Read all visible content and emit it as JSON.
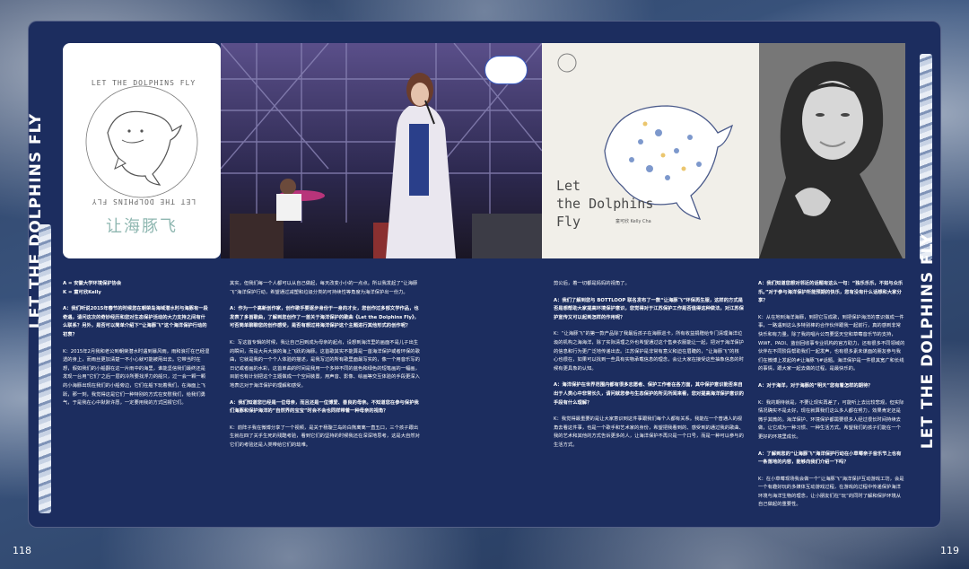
{
  "spread": {
    "side_title_left": "LET THE DOLPHINS FLY",
    "side_title_right": "LET THE DOLPHINS FLY",
    "page_left": "118",
    "page_right": "119"
  },
  "logo": {
    "ring_text_top": "LET THE DOLPHINS FLY",
    "ring_text_bottom": "LET THE DOLPHINS FLY",
    "chinese_name": "让海豚飞"
  },
  "album": {
    "title_line1": "Let",
    "title_line2": "the Dolphins",
    "title_line3": "Fly",
    "artist": "童可欣 Kelly Cha"
  },
  "text": {
    "intro1": "A = 安徽大学环境保护协会",
    "intro2": "K = 童可欣Kelly",
    "q1": "A：我们听说2015年春节的时候您在朝荣岛海域潜水时与海豚有一段奇遇，请问这次的奇妙经历和您对生态保护活动的大力支持之间有什么联系？另外，是否可以简单介绍下“让海豚飞”这个海洋保护行动的初衷？",
    "a1": "K：2015年2月我和老公到朝荣潜水时遇到暴风雨，雨和浪打在已经湿透的身上，而雨丝更加清楚一不小心就可能被甩出去。它带当时在想，假如我们的小船翻在这一片雨中的海里，谁能坚信我们最终还是发现一台用“它们”之后一层的冷所要找浮力的船只，过一会一颗一颗的小海豚出现在我们的小船旁边，它们在船下玩着我们，在海面上飞跃，那一刻，我觉得这是它们一种特别的方式在安慰我们，给我们勇气，于是我在心中默默许愿，一定要用我的方式回报它们。",
    "q2": "A：作为一个高新创作家，创作歌手要逐步身份于一身的才女，您创作过多部文学作品，也发表了多首歌曲，了解到您创作了一首关于海洋保护的歌曲《Let the Dolphins Fly》，可否简单聊聊您的创作感受，是否有想过将海洋保护这个主题进行其他形式的创作呢？",
    "a2": "K：写这首专辑的时候，我让自己回到成为母亲的起点，设想到海洋里的画面不是儿子出生的瞬间，而是大兵大浪的海上飞跃的海豚。这首歌其实不能算是一首海洋保护或者环保的歌曲，它就是我的一个个人体验的描述，是我写过的所有歌里面最写实的，像一个用音乐写的日记或者画的水彩，这首单曲的时间是我用一个多钟不同的蓝色和绿色的短笔画的一幅画，目前也有计划把这个主题做成一个空间装置，用声音、影像、绘画等交互体验的手段更深入地表达对于海洋保护的理解和感受。",
    "q3": "A：我们知道您已经是一位母亲，而且还是一位博爱、善良的母亲。不知道您在参与保护我们海豚和保护海洋的“自然界的宝宝”时会不会也同样带着一种母亲的视角？",
    "a3": "K：前阵子我在微博分享了一个视频，是关于杨璇兰岛的白熊离离一直五口，三个孩子跟出生就在四了关乎生死的残酷考验，看到它们的坚持的时候我还在深深地思考，这是大自然对它们的考验还是人类带给它们的劫难。",
    "a3b": "其实，但我们每一个人都可以从自己做起，每天改变小小的一点点。所以我发起了“让海豚飞”海洋保护行动，希望通过减塑和垃圾分类的可持续性等角度为海洋保护出一份力。",
    "a3c": "剪公后，着一切都是妈妈的视角了。",
    "q4": "A：我们了解到您与 BOTTLOOP 联名发布了一款“让海豚飞”环保再生服，这样的方式是否是想帮助大家提高环境保护意识，您觉得对于江苏保护工作是否值得这种做法，对江苏保护宣传又可以起到怎样的作用呢？",
    "a4": "K：“让海豚飞”的第一款产品除了我最后孩子在海豚巡卡，所有收益捐赠给专门清理海洋垃圾的机构之海海洋，除了实际清理之外也希望通过这个售卖衣服能让一起，把对于海洋保护的信息和行为更广泛地传递出去。江苏保护是非常有意义和迫在眉睫的，“让海豚飞”的核心也很在，如果可以找到一些具有实物承载信息的理念，会让大家在接受这些抽象信息的时候有更具象的认知。",
    "q5": "A：海洋保护在世界范围内都有很多志愿者、保护工作者在各方面，其中保护意识能否来自出于人类心中非常长久，请问就您参与生态保护的所见所闻来看，您对提高海洋保护意识的手段有什么理解？",
    "a5": "K：我觉得最重要的是让大家意识到这件事跟我们每个人都有关系。我能在一个普通人的视角去看这件事，也是一个歌手和艺术家的身份，希望把我看到的、感受到的通过我的歌曲、我的艺术和其他的方式告诉更多的人，让海洋保护不再只是一个口号，而是一种可以参与的生活方式。",
    "q6": "A：我们知道您想对邻近的话题有这么一句：“独乐乐乐，不如与众乐乐。”对于参与海洋保护所能预期的快乐，您有没有什么话想和大家分享？",
    "a6": "K：从在地到海洋海豚，到把它写成歌，到把保护海洋的意识做成一件事，一路遇到这么多特别棒的合作伙伴跟我一起前行，真的感到非常快乐和有力量。除了我的唱片公司要坚天空和草莓音乐节的支持，WWF、PADI、蓝创回收事专业机构的官方助力，还有很多不同领域的伙伴在不同阶段帮助我们一起发声，也有很多素未谋面的朋友参与我们在微博上发起的#让海豚飞#话题。海洋保护是一件很其宽广和长线的事情，跟大家一起去做的过程，是最快乐的。",
    "q7": "A：对于海洋，对于海豚的“明天”您有着怎样的期待？",
    "a7": "K：我的期待就是，不要让现实再差了，可能听上去比较悲观，但实际情况确实不是太好，现在就算我们这么多人都在努力，效果肯定还是微乎其微的。海洋保护、环境保护都需要很多人经过很长时间持续去做，让它成为一种习惯、一种生活方式。希望我们的孩子们能在一个更好的环境里成长。",
    "q8": "A：了解到您的“让海豚飞”海洋保护行动在小草莓亲子音乐节上也有一条落地的内容，能够向我们介绍一下吗？",
    "a8": "K：在小草莓现场我会做一个“让海豚飞”海洋保护互动游戏工坊，会是一个有趣好玩的多媒体互动游戏过程，在游戏的过程中传递保护海洋环境与海洋生物的理念，让小朋友们在“玩”的同时了解和保护环境从自己做起的重要性。"
  }
}
